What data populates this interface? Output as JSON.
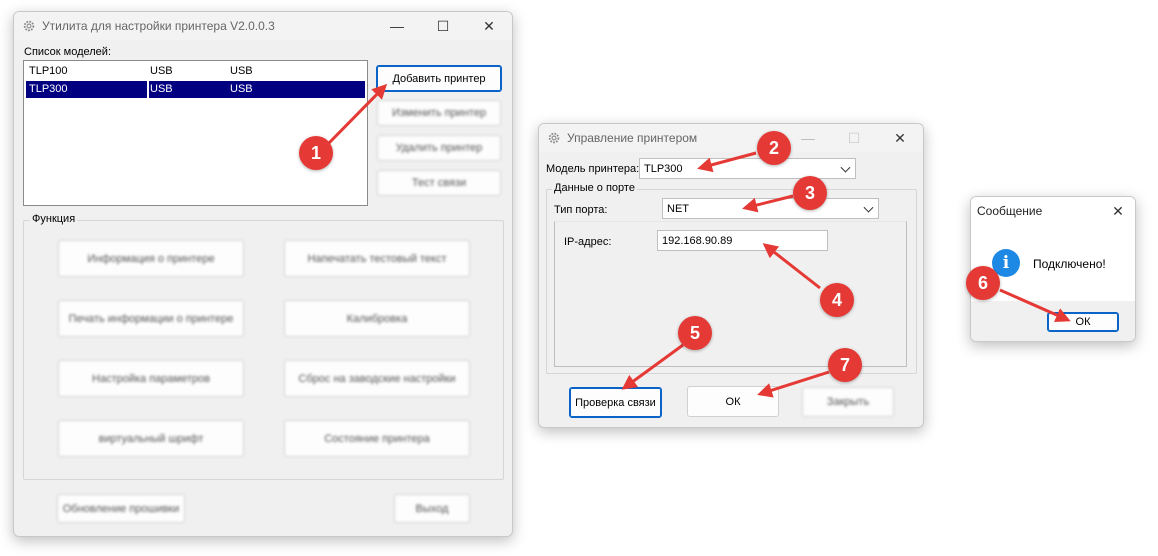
{
  "main_window": {
    "title": "Утилита для настройки принтера  V2.0.0.3",
    "models_label": "Список моделей:",
    "models": [
      {
        "name": "TLP100",
        "port": "USB",
        "conn": "USB",
        "selected": false
      },
      {
        "name": "TLP300",
        "port": "USB",
        "conn": "USB",
        "selected": true
      }
    ],
    "add_printer": "Добавить принтер",
    "edit_printer": "Изменить принтер",
    "delete_printer": "Удалить принтер",
    "test_print": "Тест связи",
    "function_label": "Функция",
    "functions": [
      "Информация о принтере",
      "Напечатать тестовый текст",
      "Печать информации о принтере",
      "Калибровка",
      "Настройка параметров",
      "Сброс на заводские настройки",
      "виртуальный шрифт",
      "Состояние принтера"
    ],
    "firmware_update": "Обновление прошивки",
    "exit": "Выход"
  },
  "printer_dialog": {
    "title": "Управление принтером",
    "model_label": "Модель принтера:",
    "model_value": "TLP300",
    "port_group_label": "Данные о порте",
    "port_type_label": "Тип порта:",
    "port_type_value": "NET",
    "ip_label": "IP-адрес:",
    "ip_value": "192.168.90.89",
    "check_connection": "Проверка связи",
    "ok": "ОК",
    "close": "Закрыть"
  },
  "message_box": {
    "title": "Сообщение",
    "message": "Подключено!",
    "ok": "ОК",
    "info_glyph": "i"
  },
  "markers": [
    "1",
    "2",
    "3",
    "4",
    "5",
    "6",
    "7"
  ],
  "colors": {
    "marker_red": "#e53935",
    "selection_navy": "#000080",
    "focus_blue": "#0a64c8",
    "info_blue": "#1e88e5"
  },
  "icons": {
    "gear": "gear-icon",
    "info": "info-icon",
    "minimize": "minimize-icon",
    "maximize": "maximize-icon",
    "close": "close-icon"
  }
}
